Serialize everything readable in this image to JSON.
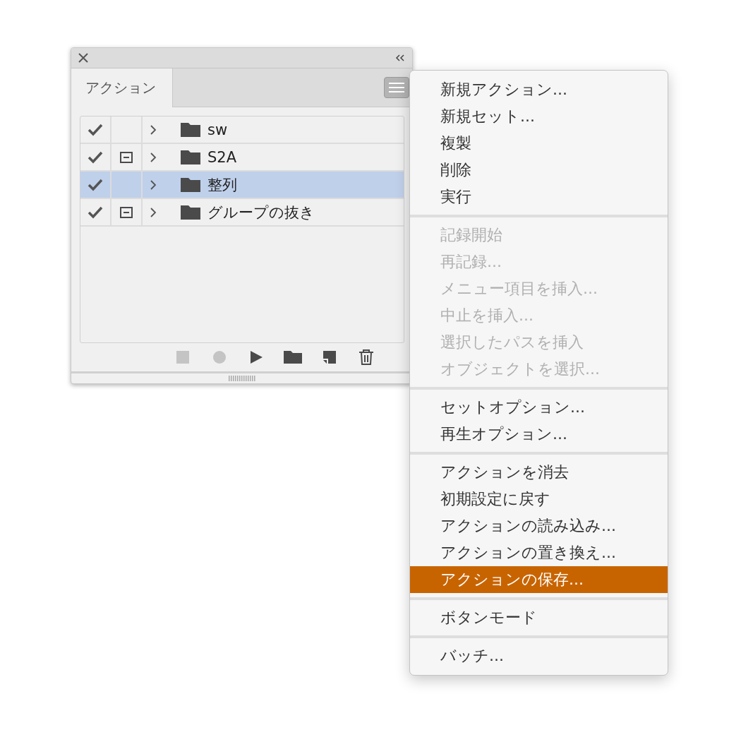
{
  "panel": {
    "tab": {
      "label": "アクション",
      "selected": true
    },
    "rows": [
      {
        "name": "sw",
        "checked": true,
        "dialog": false,
        "selected": false
      },
      {
        "name": "S2A",
        "checked": true,
        "dialog": true,
        "selected": false
      },
      {
        "name": "整列",
        "checked": true,
        "dialog": false,
        "selected": true
      },
      {
        "name": "グループの抜き",
        "checked": true,
        "dialog": true,
        "selected": false
      }
    ],
    "toolbar": [
      {
        "kind": "stop",
        "disabled": true
      },
      {
        "kind": "record",
        "disabled": true
      },
      {
        "kind": "play",
        "disabled": false
      },
      {
        "kind": "folder",
        "disabled": false
      },
      {
        "kind": "new",
        "disabled": false
      },
      {
        "kind": "trash",
        "disabled": false
      }
    ]
  },
  "menu": {
    "sections": [
      [
        {
          "label": "新規アクション...",
          "disabled": false,
          "selected": false
        },
        {
          "label": "新規セット...",
          "disabled": false,
          "selected": false
        },
        {
          "label": "複製",
          "disabled": false,
          "selected": false
        },
        {
          "label": "削除",
          "disabled": false,
          "selected": false
        },
        {
          "label": "実行",
          "disabled": false,
          "selected": false
        }
      ],
      [
        {
          "label": "記録開始",
          "disabled": true,
          "selected": false
        },
        {
          "label": "再記録...",
          "disabled": true,
          "selected": false
        },
        {
          "label": "メニュー項目を挿入...",
          "disabled": true,
          "selected": false
        },
        {
          "label": "中止を挿入...",
          "disabled": true,
          "selected": false
        },
        {
          "label": "選択したパスを挿入",
          "disabled": true,
          "selected": false
        },
        {
          "label": "オブジェクトを選択...",
          "disabled": true,
          "selected": false
        }
      ],
      [
        {
          "label": "セットオプション...",
          "disabled": false,
          "selected": false
        },
        {
          "label": "再生オプション...",
          "disabled": false,
          "selected": false
        }
      ],
      [
        {
          "label": "アクションを消去",
          "disabled": false,
          "selected": false
        },
        {
          "label": "初期設定に戻す",
          "disabled": false,
          "selected": false
        },
        {
          "label": "アクションの読み込み...",
          "disabled": false,
          "selected": false
        },
        {
          "label": "アクションの置き換え...",
          "disabled": false,
          "selected": false
        },
        {
          "label": "アクションの保存...",
          "disabled": false,
          "selected": true
        }
      ],
      [
        {
          "label": "ボタンモード",
          "disabled": false,
          "selected": false
        }
      ],
      [
        {
          "label": "バッチ...",
          "disabled": false,
          "selected": false
        }
      ]
    ]
  }
}
